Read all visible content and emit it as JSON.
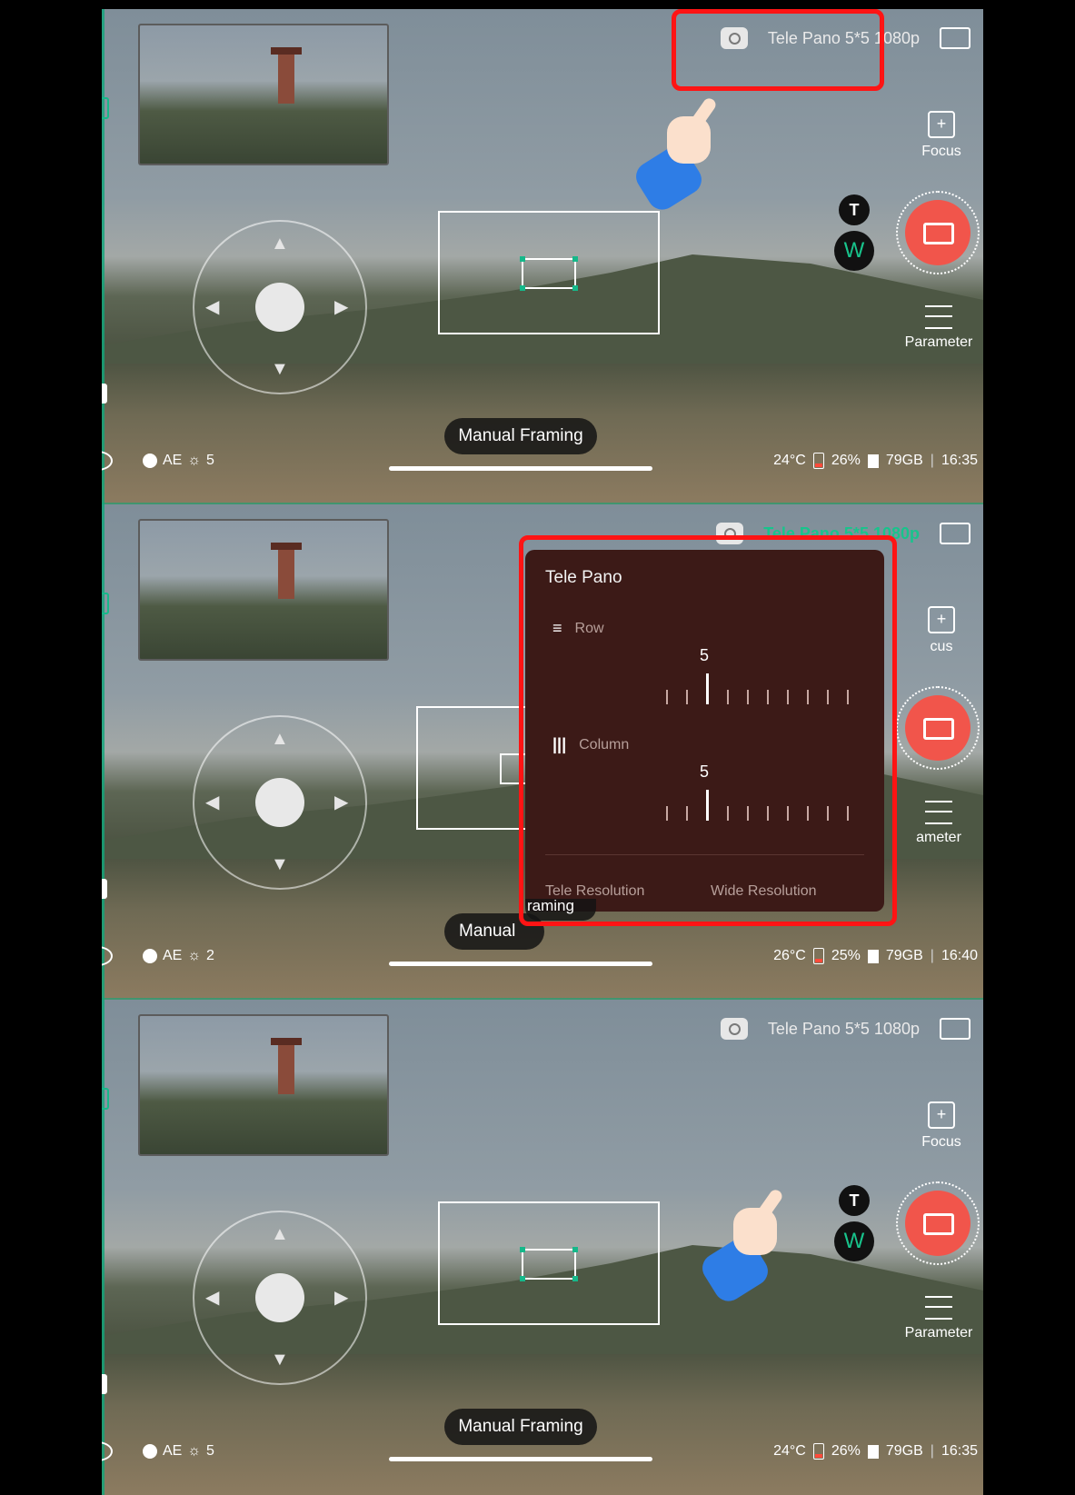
{
  "panels": [
    {
      "mode_label": "Tele Pano 5*5 1080p",
      "focus_label": "Focus",
      "parameter_label": "Parameter",
      "tele_btn": "T",
      "wide_btn": "W",
      "manual_framing": "Manual Framing",
      "status": {
        "ae": "AE",
        "exposure": "5",
        "temp": "24°C",
        "battery": "26%",
        "storage": "79GB",
        "time": "16:35"
      }
    },
    {
      "mode_label": "Tele Pano 5*5 1080p",
      "focus_label": "cus",
      "parameter_label": "ameter",
      "manual_framing": "Manual",
      "status": {
        "ae": "AE",
        "exposure": "2",
        "temp": "26°C",
        "battery": "25%",
        "storage": "79GB",
        "time": "16:40"
      },
      "popup": {
        "title": "Tele Pano",
        "row_label": "Row",
        "row_value": "5",
        "column_label": "Column",
        "column_value": "5",
        "tele_resolution": "Tele Resolution",
        "wide_resolution": "Wide Resolution",
        "partial_text": "raming"
      }
    },
    {
      "mode_label": "Tele Pano 5*5 1080p",
      "focus_label": "Focus",
      "parameter_label": "Parameter",
      "tele_btn": "T",
      "wide_btn": "W",
      "manual_framing": "Manual Framing",
      "status": {
        "ae": "AE",
        "exposure": "5",
        "temp": "24°C",
        "battery": "26%",
        "storage": "79GB",
        "time": "16:35"
      }
    }
  ],
  "icons": {
    "back": "chevron-left-icon",
    "split_view": "split-view-icon",
    "gallery": "gallery-icon",
    "eye": "eye-icon",
    "camera_switch": "camera-switch-icon",
    "panorama": "panorama-icon",
    "focus": "focus-icon",
    "parameter": "sliders-icon",
    "shutter": "shutter-icon",
    "pointer_hand": "pointing-hand-icon"
  },
  "colors": {
    "accent": "#18c48c",
    "shutter": "#f1554b",
    "highlight": "#ff1414",
    "popup_bg": "#3c1a17"
  }
}
